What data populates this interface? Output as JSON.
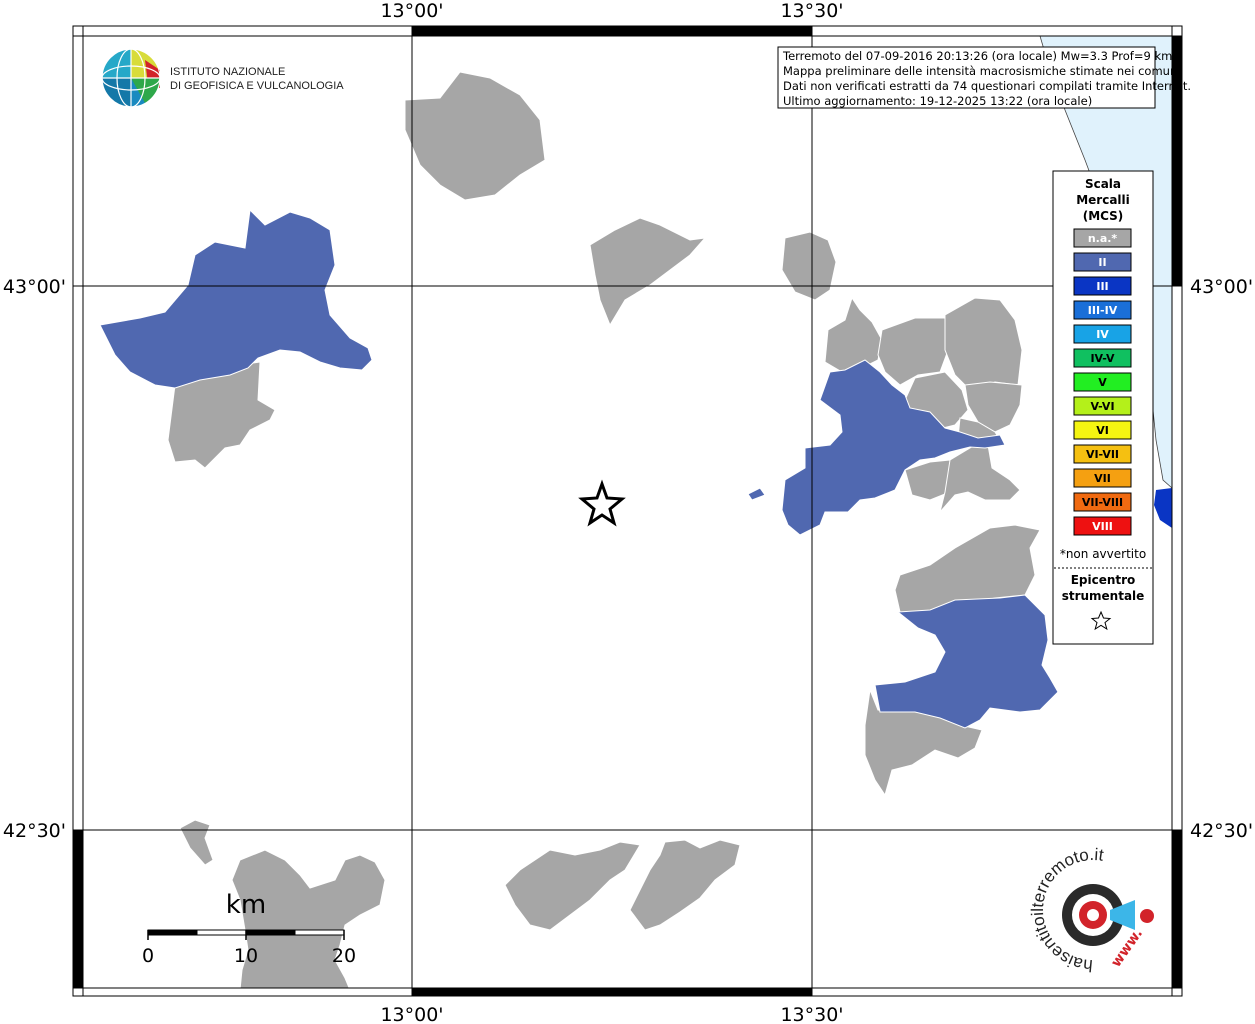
{
  "map": {
    "lon_labels": [
      "13°00'",
      "13°30'"
    ],
    "lat_labels": [
      "43°00'",
      "42°30'"
    ]
  },
  "info_box": {
    "lines": [
      "Terremoto del 07-09-2016 20:13:26 (ora locale) Mw=3.3 Prof=9 km",
      "Mappa preliminare delle intensità macrosismiche stimate nei comuni",
      "Dati non verificati estratti da 74 questionari compilati tramite Internet.",
      "Ultimo aggiornamento: 19-12-2025 13:22 (ora locale)"
    ]
  },
  "logo": {
    "line1": "ISTITUTO NAZIONALE",
    "line2": "DI GEOFISICA E VULCANOLOGIA"
  },
  "legend": {
    "title_lines": [
      "Scala",
      "Mercalli",
      "(MCS)"
    ],
    "items": [
      {
        "label": "n.a.*",
        "color": "#a6a6a6",
        "text_color": "#ffffff"
      },
      {
        "label": "II",
        "color": "#5068b0",
        "text_color": "#ffffff"
      },
      {
        "label": "III",
        "color": "#0a35c4",
        "text_color": "#ffffff"
      },
      {
        "label": "III-IV",
        "color": "#1a6fd8",
        "text_color": "#ffffff"
      },
      {
        "label": "IV",
        "color": "#18a3e6",
        "text_color": "#ffffff"
      },
      {
        "label": "IV-V",
        "color": "#10c060",
        "text_color": "#000000"
      },
      {
        "label": "V",
        "color": "#22ee22",
        "text_color": "#000000"
      },
      {
        "label": "V-VI",
        "color": "#b4f01a",
        "text_color": "#000000"
      },
      {
        "label": "VI",
        "color": "#f5f511",
        "text_color": "#000000"
      },
      {
        "label": "VI-VII",
        "color": "#f5c011",
        "text_color": "#000000"
      },
      {
        "label": "VII",
        "color": "#f5a011",
        "text_color": "#000000"
      },
      {
        "label": "VII-VIII",
        "color": "#f06a11",
        "text_color": "#000000"
      },
      {
        "label": "VIII",
        "color": "#ee1111",
        "text_color": "#ffffff"
      }
    ],
    "note": "*non avvertito",
    "epicenter_lines": [
      "Epicentro",
      "strumentale"
    ]
  },
  "scale_bar": {
    "unit": "km",
    "ticks": [
      "0",
      "10",
      "20"
    ]
  },
  "hsit_logo": {
    "text": "haisentitoilterremoto.it",
    "url_text": "www."
  },
  "colors": {
    "na": "#a6a6a6",
    "II": "#5068b0",
    "sea": "#e0f2fc",
    "sea_intensity": "#0a35c4"
  }
}
